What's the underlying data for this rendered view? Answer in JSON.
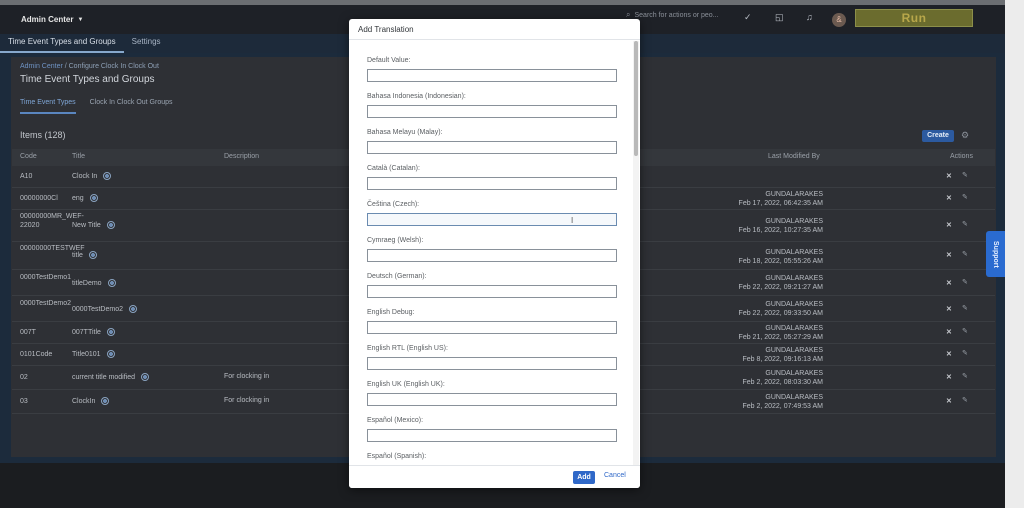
{
  "shell": {
    "product": "Admin Center",
    "search_placeholder": "Search for actions or peo...",
    "run_label": "Run",
    "avatar_initial": "&"
  },
  "tabs": [
    "Time Event Types and Groups",
    "Settings"
  ],
  "breadcrumb": {
    "link": "Admin Center",
    "rest": " / Configure Clock In Clock Out"
  },
  "page_title": "Time Event Types and Groups",
  "subtabs": [
    "Time Event Types",
    "Clock In Clock Out Groups"
  ],
  "items_label": "Items (128)",
  "create_label": "Create",
  "table": {
    "headers": [
      "Code",
      "Title",
      "Description",
      "Last Modified By",
      "Actions"
    ],
    "rows": [
      {
        "code": "A10",
        "title": "Clock In",
        "desc": "",
        "modified_by": "",
        "modified_at": ""
      },
      {
        "code": "00000000Cl",
        "title": "eng",
        "desc": "",
        "modified_by": "GUNDALARAKES",
        "modified_at": "Feb 17, 2022, 06:42:35 AM"
      },
      {
        "code": "00000000MR_WEF-22020",
        "title": "New Title",
        "desc": "",
        "modified_by": "GUNDALARAKES",
        "modified_at": "Feb 16, 2022, 10:27:35 AM"
      },
      {
        "code": "00000000TESTWEF",
        "title": "title",
        "desc": "",
        "modified_by": "GUNDALARAKES",
        "modified_at": "Feb 18, 2022, 05:55:26 AM"
      },
      {
        "code": "0000TestDemo1",
        "title": "titleDemo",
        "desc": "",
        "modified_by": "GUNDALARAKES",
        "modified_at": "Feb 22, 2022, 09:21:27 AM"
      },
      {
        "code": "0000TestDemo2",
        "title": "0000TestDemo2",
        "desc": "",
        "modified_by": "GUNDALARAKES",
        "modified_at": "Feb 22, 2022, 09:33:50 AM"
      },
      {
        "code": "007T",
        "title": "007TTitle",
        "desc": "",
        "modified_by": "GUNDALARAKES",
        "modified_at": "Feb 21, 2022, 05:27:29 AM"
      },
      {
        "code": "0101Code",
        "title": "Title0101",
        "desc": "",
        "modified_by": "GUNDALARAKES",
        "modified_at": "Feb 8, 2022, 09:16:13 AM"
      },
      {
        "code": "02",
        "title": "current title modified",
        "desc": "For clocking in",
        "modified_by": "GUNDALARAKES",
        "modified_at": "Feb 2, 2022, 08:03:30 AM"
      },
      {
        "code": "03",
        "title": "ClockIn",
        "desc": "For clocking in",
        "modified_by": "GUNDALARAKES",
        "modified_at": "Feb 2, 2022, 07:49:53 AM"
      }
    ]
  },
  "support_label": "Support",
  "modal": {
    "title": "Add Translation",
    "fields": [
      {
        "label": "Default Value:",
        "value": ""
      },
      {
        "label": "Bahasa Indonesia (Indonesian):",
        "value": ""
      },
      {
        "label": "Bahasa Melayu (Malay):",
        "value": ""
      },
      {
        "label": "Català (Catalan):",
        "value": ""
      },
      {
        "label": "Čeština (Czech):",
        "value": ""
      },
      {
        "label": "Cymraeg (Welsh):",
        "value": ""
      },
      {
        "label": "Deutsch (German):",
        "value": ""
      },
      {
        "label": "English Debug:",
        "value": ""
      },
      {
        "label": "English RTL (English US):",
        "value": ""
      },
      {
        "label": "English UK (English UK):",
        "value": ""
      },
      {
        "label": "Español (Mexico):",
        "value": ""
      },
      {
        "label": "Español (Spanish):",
        "value": ""
      }
    ],
    "add_label": "Add",
    "cancel_label": "Cancel"
  }
}
